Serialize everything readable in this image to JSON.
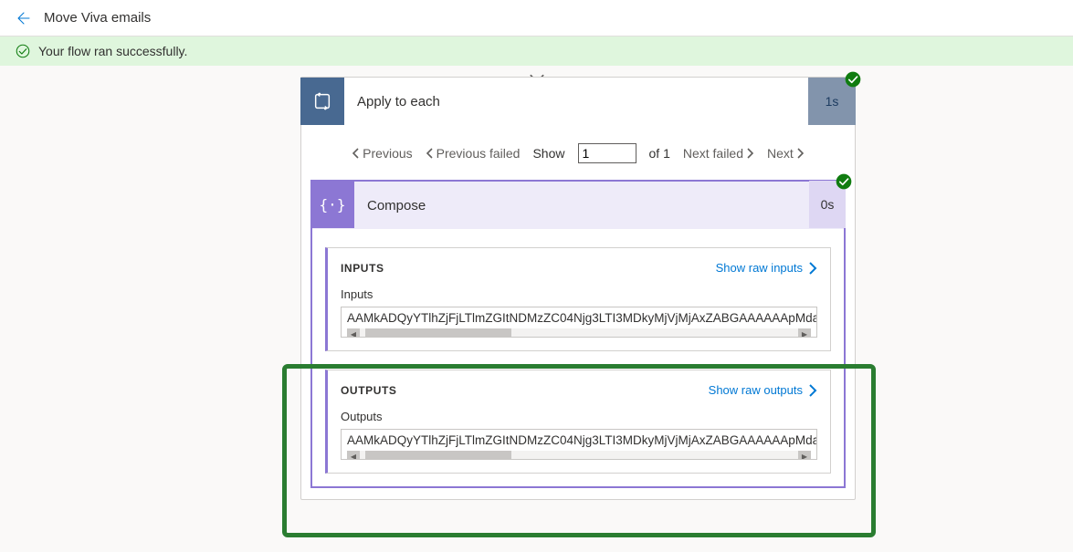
{
  "topbar": {
    "title": "Move Viva emails"
  },
  "banner": {
    "message": "Your flow ran successfully."
  },
  "applyCard": {
    "title": "Apply to each",
    "duration": "1s",
    "pagination": {
      "prev": "Previous",
      "prevFailed": "Previous failed",
      "show": "Show",
      "index": "1",
      "of": "of 1",
      "nextFailed": "Next failed",
      "next": "Next"
    }
  },
  "composeCard": {
    "title": "Compose",
    "duration": "0s",
    "inputs": {
      "heading": "INPUTS",
      "rawLink": "Show raw inputs",
      "label": "Inputs",
      "value": "AAMkADQyYTlhZjFjLTlmZGItNDMzZC04Njg3LTI3MDkyMjVjMjAxZABGAAAAAApMda"
    },
    "outputs": {
      "heading": "OUTPUTS",
      "rawLink": "Show raw outputs",
      "label": "Outputs",
      "value": "AAMkADQyYTlhZjFjLTlmZGItNDMzZC04Njg3LTI3MDkyMjVjMjAxZABGAAAAAApMda"
    }
  }
}
